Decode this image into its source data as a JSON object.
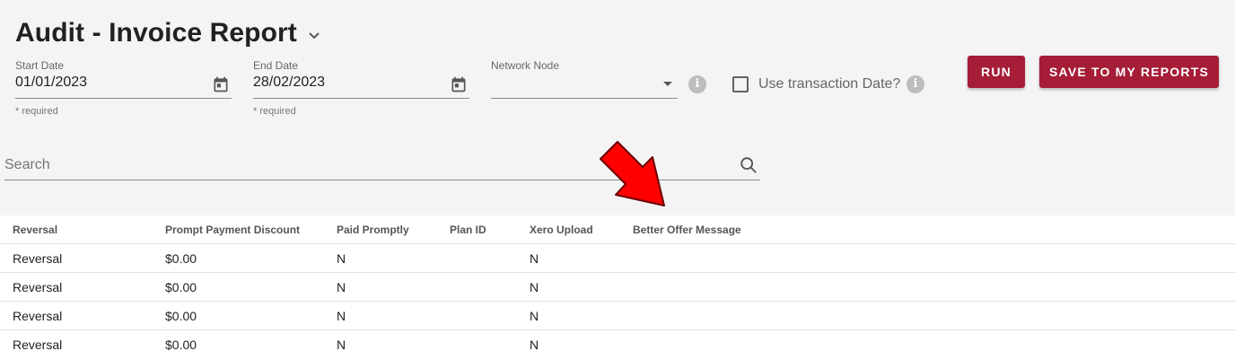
{
  "page": {
    "title": "Audit - Invoice Report",
    "title_menu_icon": "chevron-down-icon"
  },
  "filters": {
    "start_date": {
      "label": "Start Date",
      "value": "01/01/2023",
      "hint": "* required",
      "icon": "calendar-icon"
    },
    "end_date": {
      "label": "End Date",
      "value": "28/02/2023",
      "hint": "* required",
      "icon": "calendar-icon"
    },
    "network_node": {
      "label": "Network Node",
      "value": "",
      "icon": "dropdown-arrow-icon"
    },
    "info_icon_glyph": "i",
    "use_transaction_date": {
      "label": "Use transaction Date?",
      "checked": false
    }
  },
  "actions": {
    "run_label": "RUN",
    "save_label": "SAVE TO MY REPORTS",
    "accent_color": "#a51d36"
  },
  "search": {
    "placeholder": "Search",
    "icon": "search-icon"
  },
  "annotation": {
    "icon": "red-arrow-icon",
    "color": "#ff0000"
  },
  "table": {
    "columns": [
      "Reversal",
      "Prompt Payment Discount",
      "Paid Promptly",
      "Plan ID",
      "Xero Upload",
      "Better Offer Message"
    ],
    "rows": [
      [
        "Reversal",
        "$0.00",
        "N",
        "",
        "N",
        ""
      ],
      [
        "Reversal",
        "$0.00",
        "N",
        "",
        "N",
        ""
      ],
      [
        "Reversal",
        "$0.00",
        "N",
        "",
        "N",
        ""
      ],
      [
        "Reversal",
        "$0.00",
        "N",
        "",
        "N",
        ""
      ]
    ]
  }
}
